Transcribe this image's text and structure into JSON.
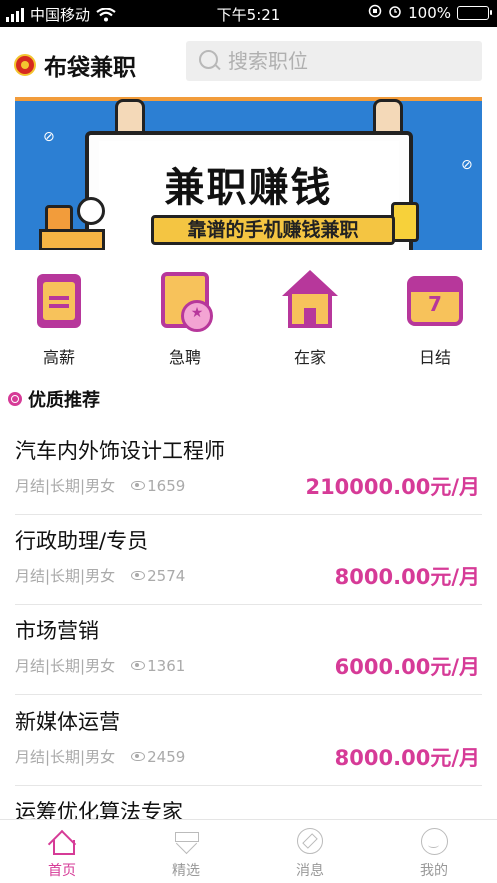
{
  "status_bar": {
    "carrier": "中国移动",
    "time": "下午5:21",
    "battery": "100%"
  },
  "header": {
    "app_title": "布袋兼职",
    "search_placeholder": "搜索职位"
  },
  "banner": {
    "title": "兼职赚钱",
    "subtitle": "靠谱的手机赚钱兼职"
  },
  "categories": [
    {
      "label": "高薪",
      "icon": "document-icon"
    },
    {
      "label": "急聘",
      "icon": "urgent-icon"
    },
    {
      "label": "在家",
      "icon": "house-icon"
    },
    {
      "label": "日结",
      "icon": "calendar-icon",
      "icon_text": "7"
    }
  ],
  "section": {
    "title": "优质推荐"
  },
  "jobs": [
    {
      "title": "汽车内外饰设计工程师",
      "tags": "月结|长期|男女",
      "views": "1659",
      "salary": "210000.00元/月"
    },
    {
      "title": "行政助理/专员",
      "tags": "月结|长期|男女",
      "views": "2574",
      "salary": "8000.00元/月"
    },
    {
      "title": "市场营销",
      "tags": "月结|长期|男女",
      "views": "1361",
      "salary": "6000.00元/月"
    },
    {
      "title": "新媒体运营",
      "tags": "月结|长期|男女",
      "views": "2459",
      "salary": "8000.00元/月"
    },
    {
      "title": "运筹优化算法专家",
      "tags": "",
      "views": "",
      "salary": ""
    }
  ],
  "tabbar": [
    {
      "label": "首页",
      "icon": "home-icon",
      "active": true
    },
    {
      "label": "精选",
      "icon": "diamond-icon",
      "active": false
    },
    {
      "label": "消息",
      "icon": "compass-icon",
      "active": false
    },
    {
      "label": "我的",
      "icon": "user-icon",
      "active": false
    }
  ],
  "colors": {
    "accent": "#d63b97",
    "icon_purple": "#b7379b",
    "icon_yellow": "#f7c25b",
    "banner_blue": "#2c7fd3"
  }
}
